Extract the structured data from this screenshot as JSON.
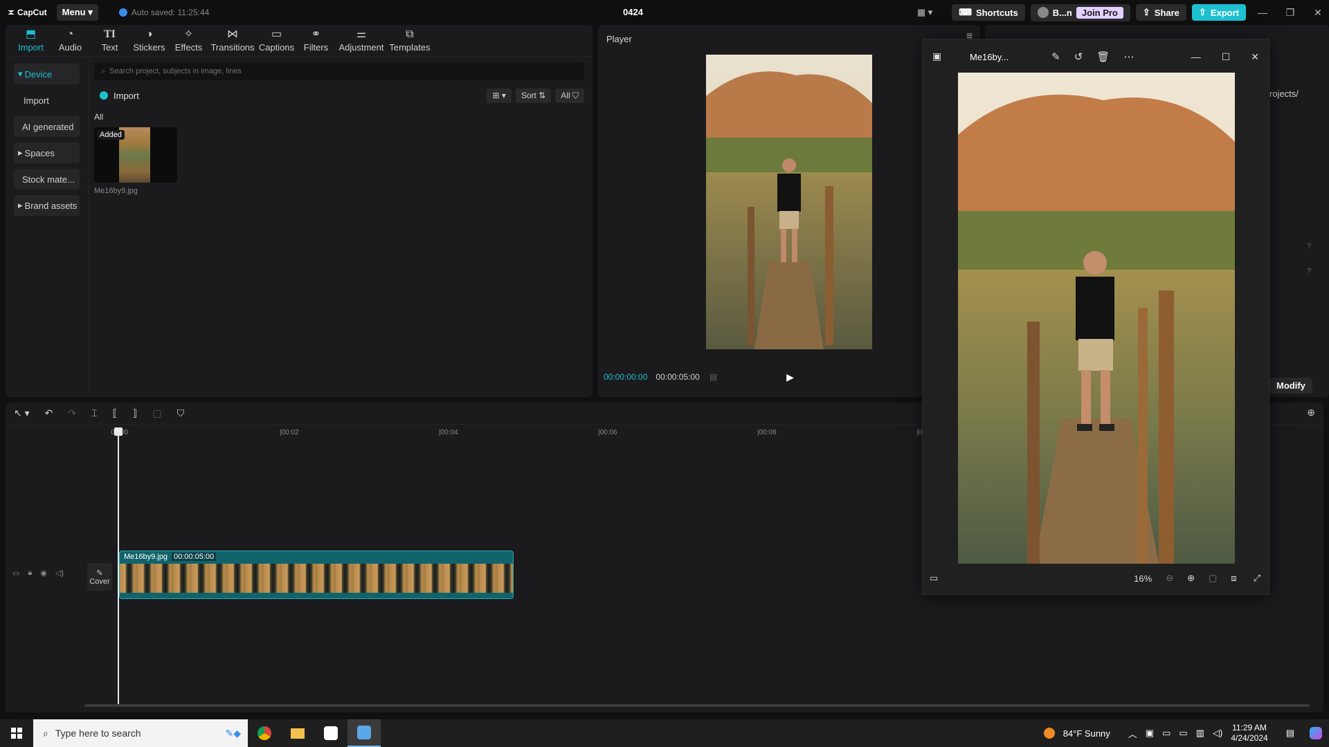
{
  "app": {
    "logo": "CapCut",
    "menu_label": "Menu",
    "autosave": "Auto saved: 11:25:44",
    "project_title": "0424",
    "shortcuts_label": "Shortcuts",
    "user_label": "B...n",
    "join_pro_label": "Join Pro",
    "share_label": "Share",
    "export_label": "Export"
  },
  "tabs": [
    {
      "label": "Import",
      "icon": "import-icon"
    },
    {
      "label": "Audio",
      "icon": "audio-icon"
    },
    {
      "label": "Text",
      "icon": "text-icon"
    },
    {
      "label": "Stickers",
      "icon": "stickers-icon"
    },
    {
      "label": "Effects",
      "icon": "effects-icon"
    },
    {
      "label": "Transitions",
      "icon": "transitions-icon"
    },
    {
      "label": "Captions",
      "icon": "captions-icon"
    },
    {
      "label": "Filters",
      "icon": "filters-icon"
    },
    {
      "label": "Adjustment",
      "icon": "adjustment-icon"
    },
    {
      "label": "Templates",
      "icon": "templates-icon"
    }
  ],
  "sidebar": [
    {
      "label": "Device"
    },
    {
      "label": "Import"
    },
    {
      "label": "AI generated"
    },
    {
      "label": "Spaces"
    },
    {
      "label": "Stock mate..."
    },
    {
      "label": "Brand assets"
    }
  ],
  "media": {
    "search_placeholder": "Search project, subjects in image, lines",
    "import_label": "Import",
    "sort_label": "Sort",
    "all_filter_label": "All",
    "all_heading": "All",
    "item": {
      "name": "Me16by9.jpg",
      "badge": "Added"
    }
  },
  "player": {
    "title": "Player",
    "current_time": "00:00:00:00",
    "total_time": "00:00:05:00"
  },
  "details": {
    "path_fragment": "rojects/",
    "modify_label": "Modify"
  },
  "viewer": {
    "file_name": "Me16by...",
    "zoom": "16%"
  },
  "timeline": {
    "ticks": [
      "00:00",
      "|00:02",
      "|00:04",
      "|00:06",
      "|00:08",
      "|00"
    ],
    "clip_name": "Me16by9.jpg",
    "clip_duration": "00:00:05:00",
    "cover_label": "Cover"
  },
  "taskbar": {
    "search_placeholder": "Type here to search",
    "weather": "84°F  Sunny",
    "time": "11:29 AM",
    "date": "4/24/2024"
  },
  "colors": {
    "accent": "#1ebfd1",
    "clip": "#11636b",
    "panel": "#1b1b1d"
  }
}
